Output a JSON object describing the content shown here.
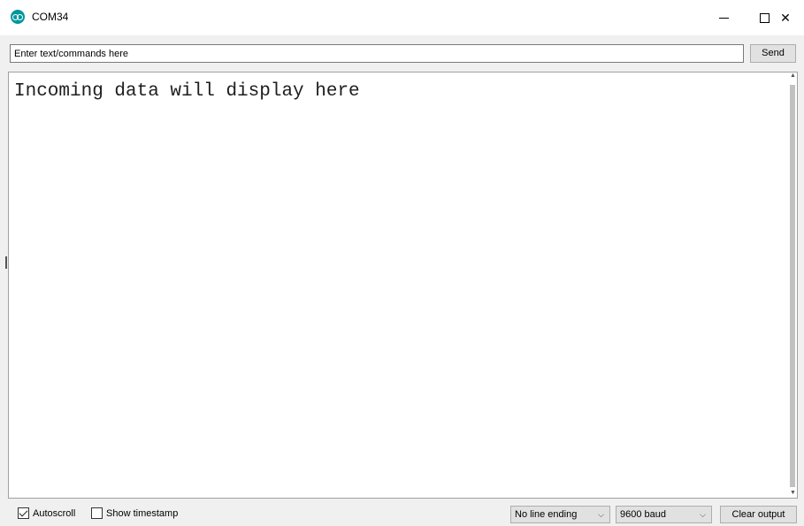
{
  "window": {
    "title": "COM34",
    "icon": "arduino-icon",
    "minimize_icon": "minimize-icon",
    "maximize_icon": "maximize-icon",
    "close_glyph": "✕"
  },
  "send_bar": {
    "input_value": "Enter text/commands here",
    "send_label": "Send"
  },
  "output": {
    "text": "Incoming data will display here"
  },
  "status_bar": {
    "autoscroll_label": "Autoscroll",
    "autoscroll_checked": true,
    "timestamp_label": "Show timestamp",
    "timestamp_checked": false,
    "line_ending": "No line ending",
    "baud_rate": "9600 baud",
    "clear_label": "Clear output",
    "chevron_glyph": "⌵"
  },
  "colors": {
    "brand": "#00979d",
    "chrome": "#f0f0f0",
    "button_face": "#e1e1e1"
  }
}
